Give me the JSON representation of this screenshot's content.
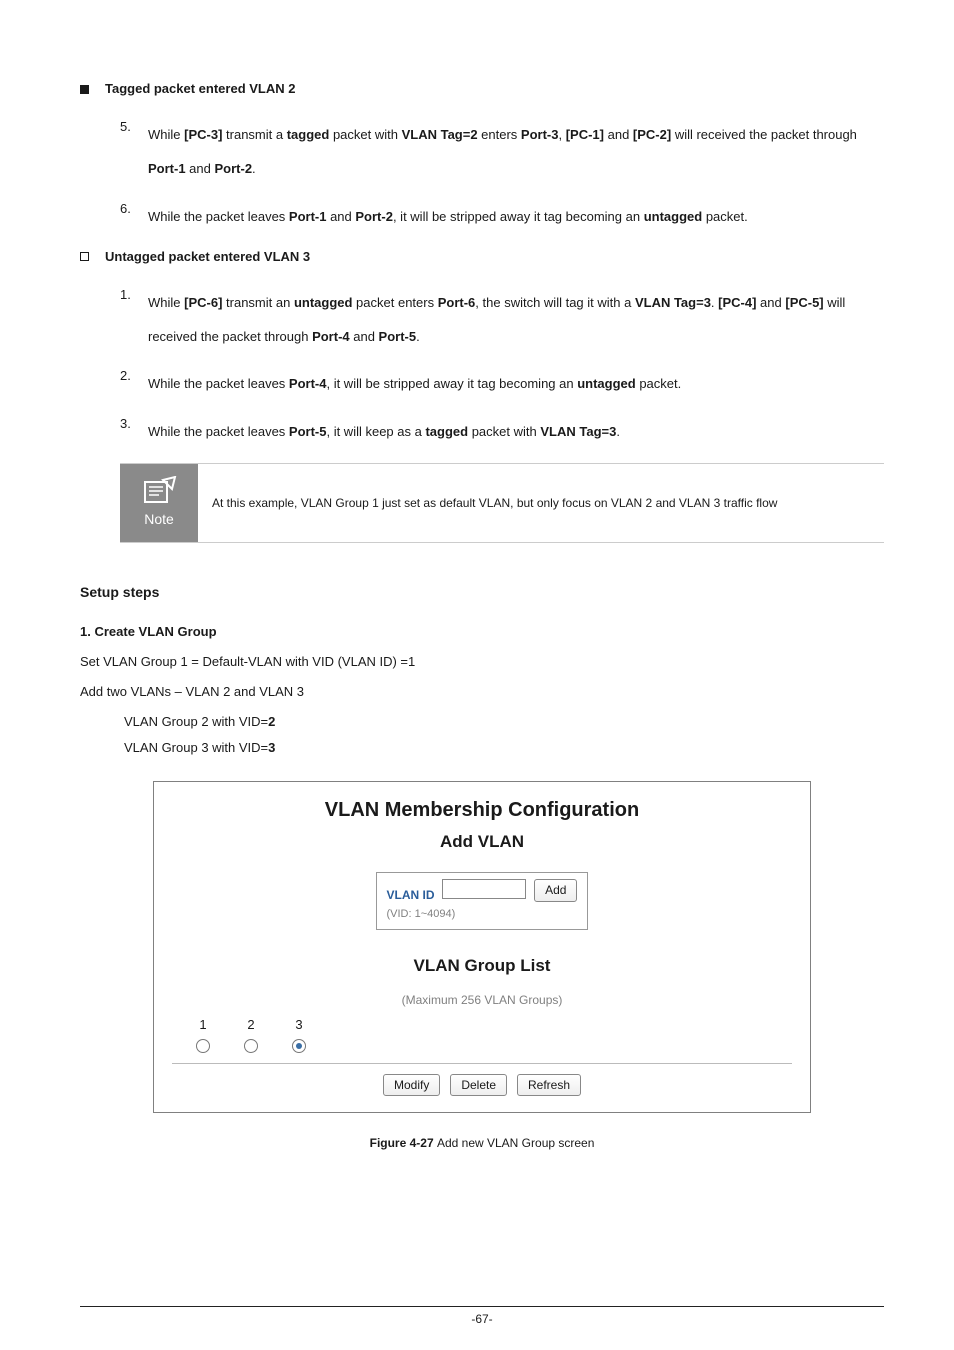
{
  "sectionA": {
    "title": "Tagged packet entered VLAN 2",
    "items": [
      {
        "num": "5.",
        "parts": [
          "While ",
          "[PC-3]",
          " transmit a ",
          "tagged",
          " packet with ",
          "VLAN Tag=2",
          " enters ",
          "Port-3",
          ", ",
          "[PC-1]",
          " and ",
          "[PC-2]",
          " will received the packet through ",
          "Port-1",
          " and ",
          "Port-2",
          "."
        ]
      },
      {
        "num": "6.",
        "parts": [
          "While the packet leaves ",
          "Port-1",
          " and ",
          "Port-2",
          ", it will be stripped away it tag becoming an ",
          "untagged",
          " packet."
        ]
      }
    ]
  },
  "sectionB": {
    "title": "Untagged packet entered VLAN 3",
    "items": [
      {
        "num": "1.",
        "parts": [
          "While ",
          "[PC-6]",
          " transmit an ",
          "untagged",
          " packet enters ",
          "Port-6",
          ", the switch will tag it with a ",
          "VLAN Tag=3",
          ". ",
          "[PC-4]",
          " and ",
          "[PC-5]",
          " will received the packet through ",
          "Port-4",
          " and ",
          "Port-5",
          "."
        ]
      },
      {
        "num": "2.",
        "parts": [
          "While the packet leaves ",
          "Port-4",
          ", it will be stripped away it tag becoming an ",
          "untagged",
          " packet."
        ]
      },
      {
        "num": "3.",
        "parts": [
          "While the packet leaves ",
          "Port-5",
          ", it will keep as a ",
          "tagged",
          " packet with ",
          "VLAN Tag=3",
          "."
        ]
      }
    ]
  },
  "note": {
    "label": "Note",
    "text": "At this example, VLAN Group 1 just set as default VLAN, but only focus on VLAN 2 and VLAN 3 traffic flow"
  },
  "setup": {
    "title": "Setup steps",
    "step1": {
      "label": "1. Create VLAN Group",
      "desc": "Set VLAN Group 1 = Default-VLAN with VID (VLAN ID) =1",
      "sub0": "Add two VLANs – VLAN 2 and VLAN 3",
      "sub1_pre": "VLAN Group 2 with VID=",
      "sub1_b": "2",
      "sub2_pre": "VLAN Group 3 with VID=",
      "sub2_b": "3"
    }
  },
  "figure": {
    "h2": "VLAN Membership Configuration",
    "h3a": "Add VLAN",
    "vlanIdLabel": "VLAN ID",
    "vlanRange": "(VID: 1~4094)",
    "addBtn": "Add",
    "h3b": "VLAN Group List",
    "maxNote": "(Maximum 256 VLAN Groups)",
    "groups": [
      "1",
      "2",
      "3"
    ],
    "btns": {
      "modify": "Modify",
      "delete": "Delete",
      "refresh": "Refresh"
    },
    "captionPre": "Figure 4-27 ",
    "caption": "Add new VLAN Group screen"
  },
  "pageNum": "-67-"
}
